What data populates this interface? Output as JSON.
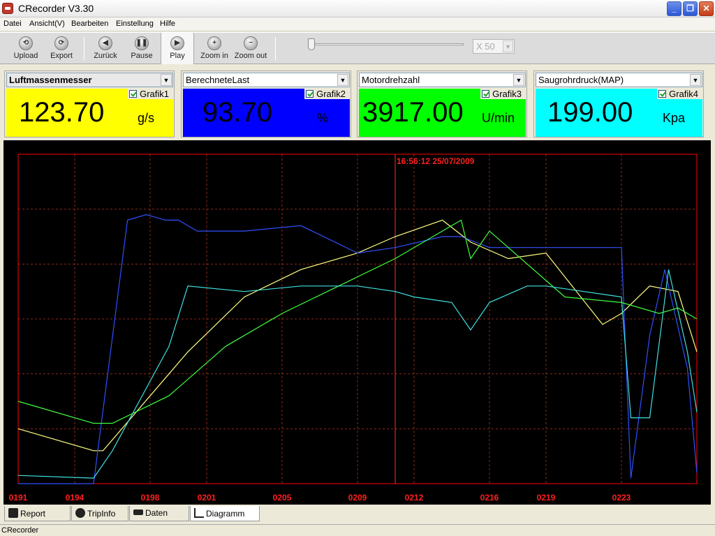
{
  "window": {
    "title": "CRecorder V3.30",
    "min": "_",
    "max": "❐",
    "close": "✕"
  },
  "menu": [
    "Datei",
    "Ansicht(V)",
    "Bearbeiten",
    "Einstellung",
    "Hilfe"
  ],
  "toolbar": {
    "upload": "Upload",
    "export": "Export",
    "back": "Zurück",
    "pause": "Pause",
    "play": "Play",
    "zoom_in": "Zoom in",
    "zoom_out": "Zoom out",
    "speed": "X 50",
    "speed_position": 0.0
  },
  "gauges": [
    {
      "sensor": "Luftmassenmesser",
      "graph": "Grafik1",
      "value": "123.70",
      "unit": "g/s",
      "color": "#ffff00"
    },
    {
      "sensor": "BerechneteLast",
      "graph": "Grafik2",
      "value": "93.70",
      "unit": "%",
      "color": "#0000ff"
    },
    {
      "sensor": "Motordrehzahl",
      "graph": "Grafik3",
      "value": "3917.00",
      "unit": "U/min",
      "color": "#00ff00"
    },
    {
      "sensor": "Saugrohrdruck(MAP)",
      "graph": "Grafik4",
      "value": "199.00",
      "unit": "Kpa",
      "color": "#00ffff"
    }
  ],
  "chart_data": {
    "type": "line",
    "cursor_label": "16:56:12 25/07/2009",
    "cursor_x": 211,
    "x_ticks": [
      "0191",
      "0194",
      "0198",
      "0201",
      "0205",
      "0209",
      "0212",
      "0216",
      "0219",
      "0223"
    ],
    "xlim": [
      191,
      227
    ],
    "ylim": [
      0,
      6
    ],
    "grid": true,
    "grid_color": "#8b2a1a",
    "border_color": "#ff0000",
    "series": [
      {
        "color": "#ffff80",
        "x": [
          191,
          195,
          195.5,
          199,
          200,
          203,
          206,
          209,
          211,
          213.5,
          215,
          217,
          219,
          222,
          223,
          224.5,
          226,
          227
        ],
        "y": [
          1.0,
          0.6,
          0.6,
          2.0,
          2.4,
          3.4,
          3.9,
          4.2,
          4.5,
          4.8,
          4.4,
          4.1,
          4.2,
          2.9,
          3.1,
          3.6,
          3.5,
          2.4
        ]
      },
      {
        "color": "#3050ff",
        "x": [
          191,
          195,
          196.8,
          197.8,
          198.8,
          199.5,
          200.5,
          203,
          206,
          209,
          211,
          213.5,
          214.5,
          216,
          218,
          223,
          223.5,
          224.5,
          225.3,
          226.5,
          227
        ],
        "y": [
          0.0,
          0.0,
          4.8,
          4.9,
          4.8,
          4.8,
          4.6,
          4.6,
          4.7,
          4.2,
          4.3,
          4.5,
          4.5,
          4.3,
          4.3,
          4.3,
          0.1,
          2.7,
          3.9,
          2.1,
          0.2
        ]
      },
      {
        "color": "#40ff40",
        "x": [
          191,
          195,
          196,
          199,
          202,
          205,
          208,
          211,
          213.5,
          214.5,
          215,
          216,
          217,
          220,
          223,
          225,
          226,
          227
        ],
        "y": [
          1.5,
          1.1,
          1.1,
          1.6,
          2.5,
          3.1,
          3.6,
          4.1,
          4.6,
          4.8,
          4.1,
          4.6,
          4.3,
          3.4,
          3.3,
          3.1,
          3.2,
          3.0
        ]
      },
      {
        "color": "#40e0e0",
        "x": [
          191,
          195,
          196,
          199,
          200,
          203,
          206,
          209,
          211,
          212,
          214,
          215,
          216,
          218,
          219,
          223,
          223.5,
          224.5,
          225.5,
          226.5,
          227
        ],
        "y": [
          0.15,
          0.1,
          0.6,
          2.5,
          3.6,
          3.5,
          3.6,
          3.6,
          3.5,
          3.4,
          3.3,
          2.8,
          3.3,
          3.6,
          3.6,
          3.4,
          1.2,
          1.2,
          3.9,
          2.4,
          1.3
        ]
      }
    ]
  },
  "tabs": [
    "Report",
    "TripInfo",
    "Daten",
    "Diagramm"
  ],
  "status": "CRecorder"
}
